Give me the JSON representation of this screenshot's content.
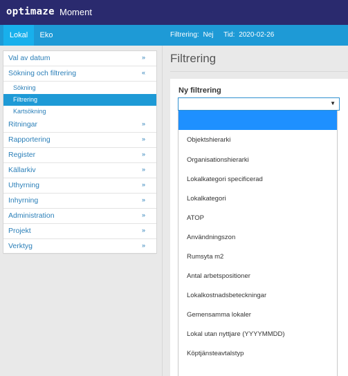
{
  "header": {
    "brand": "optimaze",
    "app": "Moment"
  },
  "tabs": [
    {
      "label": "Lokal"
    },
    {
      "label": "Eko"
    }
  ],
  "status": {
    "filter_label": "Filtrering:",
    "filter_value": "Nej",
    "date_label": "Tid:",
    "date_value": "2020-02-26"
  },
  "sidebar": {
    "items": [
      {
        "label": "Val av datum",
        "chevron": "»"
      },
      {
        "label": "Sökning och filtrering",
        "chevron": "«"
      },
      {
        "label": "Ritningar",
        "chevron": "»"
      },
      {
        "label": "Rapportering",
        "chevron": "»"
      },
      {
        "label": "Register",
        "chevron": "»"
      },
      {
        "label": "Källarkiv",
        "chevron": "»"
      },
      {
        "label": "Uthyrning",
        "chevron": "»"
      },
      {
        "label": "Inhyrning",
        "chevron": "»"
      },
      {
        "label": "Administration",
        "chevron": "»"
      },
      {
        "label": "Projekt",
        "chevron": "»"
      },
      {
        "label": "Verktyg",
        "chevron": "»"
      }
    ],
    "subitems": [
      {
        "label": "Sökning"
      },
      {
        "label": "Filtrering"
      },
      {
        "label": "Kartsökning"
      }
    ]
  },
  "main": {
    "title": "Filtrering",
    "field_label": "Ny filtrering",
    "select_value": "",
    "options": [
      "",
      "Objektshierarki",
      "Organisationshierarki",
      "Lokalkategori specificerad",
      "Lokalkategori",
      "ATOP",
      "Användningszon",
      "Rumsyta m2",
      "Antal arbetspositioner",
      "Lokalkostnadsbeteckningar",
      "Gemensamma lokaler",
      "Lokal utan nyttjare (YYYYMMDD)",
      "Köptjänsteavtalstyp"
    ]
  }
}
